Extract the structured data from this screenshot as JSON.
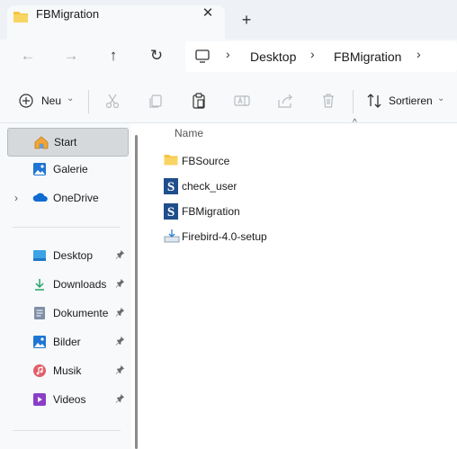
{
  "window": {
    "tab_title": "FBMigration",
    "close_glyph": "✕",
    "new_tab_glyph": "+"
  },
  "navigation": {
    "back_glyph": "←",
    "forward_glyph": "→",
    "up_glyph": "↑",
    "refresh_glyph": "↻",
    "breadcrumb_separator": "›",
    "breadcrumbs": [
      {
        "label": "Desktop"
      },
      {
        "label": "FBMigration"
      }
    ]
  },
  "toolbar": {
    "new_label": "Neu",
    "sort_label": "Sortieren",
    "chevron_glyph": "⌄",
    "icons": [
      "cut-icon",
      "copy-icon",
      "paste-icon",
      "rename-icon",
      "share-icon",
      "delete-icon"
    ]
  },
  "sidebar": {
    "pin_glyph": "📌",
    "expand_glyph": "›",
    "items": [
      {
        "label": "Start",
        "icon": "home-icon",
        "selected": true
      },
      {
        "label": "Galerie",
        "icon": "gallery-icon"
      },
      {
        "label": "OneDrive",
        "icon": "cloud-icon",
        "expandable": true
      }
    ],
    "quick_access": [
      {
        "label": "Desktop",
        "icon": "desktop-folder-icon",
        "pinned": true
      },
      {
        "label": "Downloads",
        "icon": "download-icon",
        "pinned": true
      },
      {
        "label": "Dokumente",
        "icon": "documents-icon",
        "pinned": true
      },
      {
        "label": "Bilder",
        "icon": "pictures-icon",
        "pinned": true
      },
      {
        "label": "Musik",
        "icon": "music-icon",
        "pinned": true
      },
      {
        "label": "Videos",
        "icon": "videos-icon",
        "pinned": true
      }
    ]
  },
  "content": {
    "column_header": "Name",
    "sort_caret": "^",
    "files": [
      {
        "name": "FBSource",
        "icon": "folder-icon"
      },
      {
        "name": "check_user",
        "icon": "script-s-icon"
      },
      {
        "name": "FBMigration",
        "icon": "script-s-icon"
      },
      {
        "name": "Firebird-4.0-setup",
        "icon": "installer-icon"
      }
    ]
  },
  "colors": {
    "folder_yellow": "#f4c542",
    "accent_blue": "#1f5fbf",
    "selected_bg": "#d6d9dc"
  }
}
